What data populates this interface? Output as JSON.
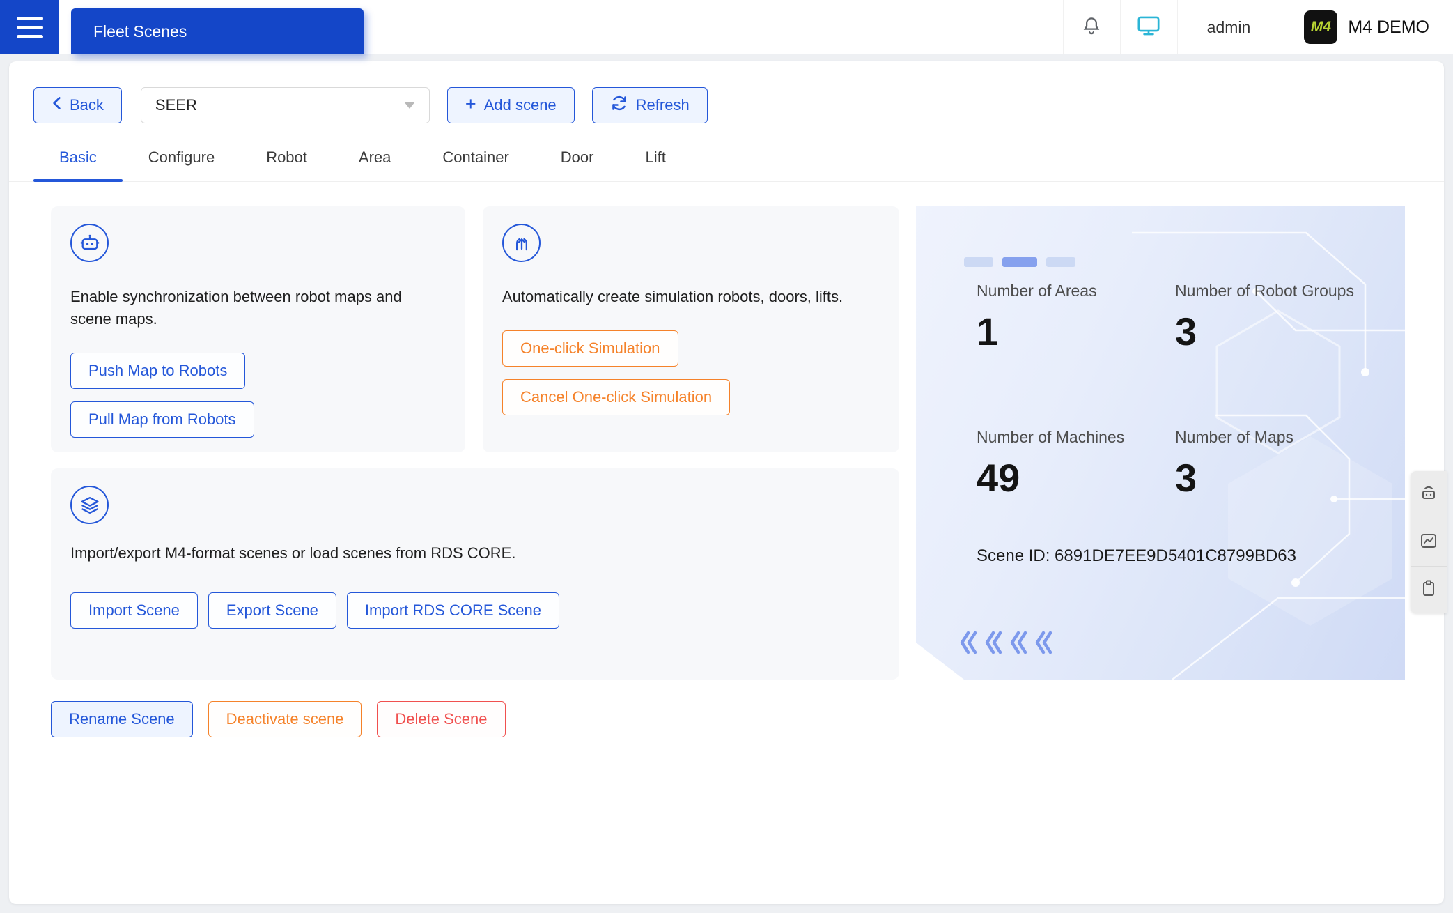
{
  "topbar": {
    "tab": "Fleet Scenes",
    "user": "admin",
    "logo_text": "M4",
    "brand": "M4 DEMO"
  },
  "toolbar": {
    "back": "Back",
    "scene_selected": "SEER",
    "add_scene": "Add scene",
    "refresh": "Refresh"
  },
  "icons": {
    "plus": "+"
  },
  "tabs": [
    {
      "label": "Basic",
      "active": true
    },
    {
      "label": "Configure",
      "active": false
    },
    {
      "label": "Robot",
      "active": false
    },
    {
      "label": "Area",
      "active": false
    },
    {
      "label": "Container",
      "active": false
    },
    {
      "label": "Door",
      "active": false
    },
    {
      "label": "Lift",
      "active": false
    }
  ],
  "cards": {
    "map_sync": {
      "description": "Enable synchronization between robot maps and scene maps.",
      "push_button": "Push Map to Robots",
      "pull_button": "Pull Map from Robots"
    },
    "simulation": {
      "description": "Automatically create simulation robots, doors, lifts.",
      "one_click_button": "One-click Simulation",
      "cancel_button": "Cancel One-click Simulation"
    },
    "scene_io": {
      "description": "Import/export M4-format scenes or load scenes from RDS CORE.",
      "import_button": "Import Scene",
      "export_button": "Export Scene",
      "import_rds_button": "Import RDS CORE Scene"
    }
  },
  "stats": {
    "areas_label": "Number of Areas",
    "areas_value": "1",
    "robot_groups_label": "Number of Robot Groups",
    "robot_groups_value": "3",
    "machines_label": "Number of Machines",
    "machines_value": "49",
    "maps_label": "Number of Maps",
    "maps_value": "3",
    "scene_id": "Scene ID: 6891DE7EE9D5401C8799BD63"
  },
  "scene_actions": {
    "rename": "Rename Scene",
    "deactivate": "Deactivate scene",
    "delete": "Delete Scene"
  },
  "colors": {
    "primary_blue": "#1446c8",
    "accent_blue": "#2457d9",
    "accent_orange": "#f5822a",
    "accent_red": "#f0504f",
    "monitor_cyan": "#2ab5d6",
    "logo_green": "#b8d433"
  }
}
